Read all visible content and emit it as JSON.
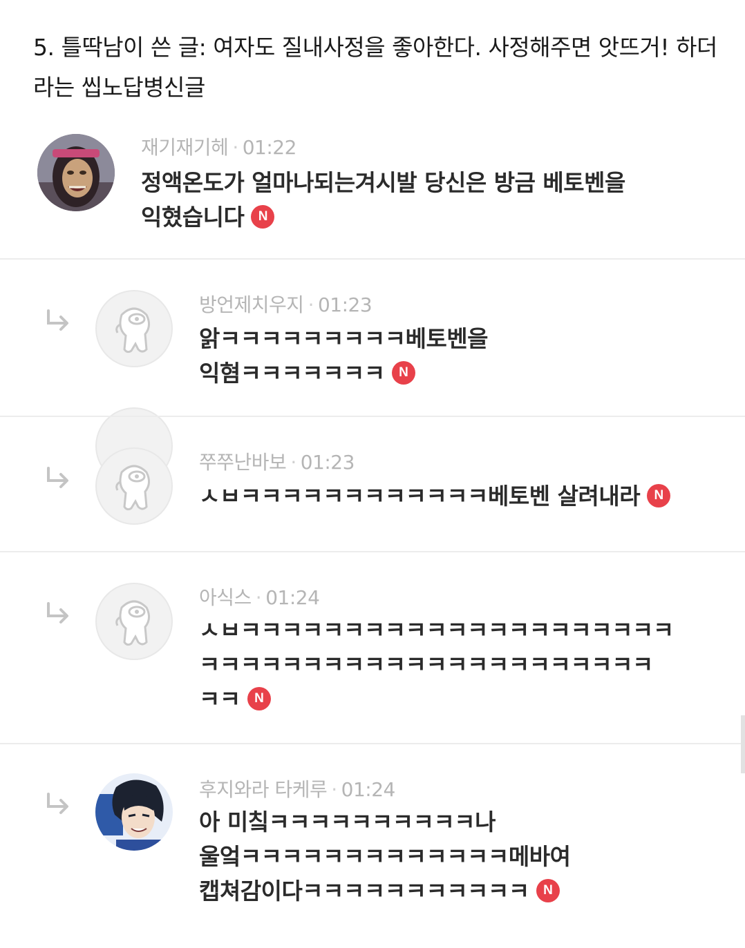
{
  "post": {
    "title": "5. 틀딱남이 쓴 글: 여자도 질내사정을 좋아한다. 사정해주면 앗뜨거! 하더라는 씹노답병신글"
  },
  "comments": [
    {
      "author": "재기재기헤",
      "time": "01:22",
      "lines": [
        "정액온도가 얼마나되는겨시발 당신은 방금 베토벤을",
        "익혔습니다"
      ],
      "badge": "N",
      "avatar": "villain-avatar",
      "reply": false
    },
    {
      "author": "방언제치우지",
      "time": "01:23",
      "lines": [
        "앍ㅋㅋㅋㅋㅋㅋㅋㅋㅋ베토벤을",
        "익혐ㅋㅋㅋㅋㅋㅋㅋ"
      ],
      "badge": "N",
      "avatar": "default-avatar",
      "reply": true
    },
    {
      "author": "쭈쭈난바보",
      "time": "01:23",
      "lines": [
        "ㅅㅂㅋㅋㅋㅋㅋㅋㅋㅋㅋㅋㅋㅋ베토벤 살려내라"
      ],
      "badge": "N",
      "avatar": "default-avatar",
      "reply": true
    },
    {
      "author": "아식스",
      "time": "01:24",
      "lines": [
        "ㅅㅂㅋㅋㅋㅋㅋㅋㅋㅋㅋㅋㅋㅋㅋㅋㅋㅋㅋㅋㅋㅋㅋ",
        "ㅋㅋㅋㅋㅋㅋㅋㅋㅋㅋㅋㅋㅋㅋㅋㅋㅋㅋㅋㅋㅋㅋ",
        "ㅋㅋ"
      ],
      "badge": "N",
      "avatar": "default-avatar",
      "reply": true
    },
    {
      "author": "후지와라 타케루",
      "time": "01:24",
      "lines": [
        "아 미칰ㅋㅋㅋㅋㅋㅋㅋㅋㅋㅋ나",
        "울엌ㅋㅋㅋㅋㅋㅋㅋㅋㅋㅋㅋㅋㅋ메바여",
        "캡쳐감이다ㅋㅋㅋㅋㅋㅋㅋㅋㅋㅋㅋ"
      ],
      "badge": "N",
      "avatar": "anime-avatar",
      "reply": true
    }
  ],
  "colors": {
    "badge": "#e8414a",
    "meta": "#b5b5b5",
    "divider": "#ececec"
  }
}
